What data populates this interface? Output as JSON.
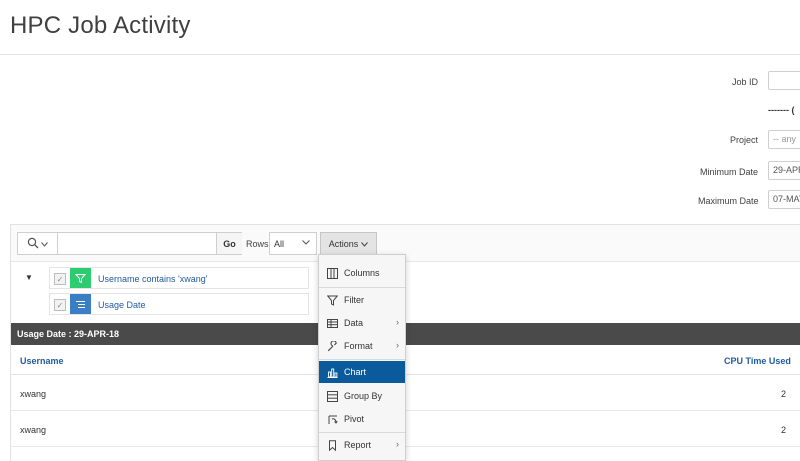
{
  "page": {
    "title": "HPC Job Activity"
  },
  "form": {
    "job_id_label": "Job ID",
    "job_id_value": "",
    "separator_text": "------- (",
    "project_label": "Project",
    "project_placeholder": "-- any",
    "min_date_label": "Minimum Date",
    "min_date_value": "29-APR",
    "max_date_label": "Maximum Date",
    "max_date_value": "07-MAY"
  },
  "toolbar": {
    "search_value": "",
    "go_label": "Go",
    "rows_label": "Rows",
    "rows_value": "All",
    "actions_label": "Actions"
  },
  "filters": [
    {
      "text": "Username contains 'xwang'",
      "icon": "filter-icon",
      "color": "#2ecc71"
    },
    {
      "text": "Usage Date",
      "icon": "control-break-icon",
      "color": "#3a7fc4"
    }
  ],
  "report": {
    "break_label": "Usage Date : 29-APR-18",
    "columns": {
      "username": "Username",
      "cpu_time": "CPU Time Used"
    },
    "rows": [
      {
        "username": "xwang",
        "cpu_time": "2"
      },
      {
        "username": "xwang",
        "cpu_time": "2"
      }
    ]
  },
  "menu": {
    "items": [
      {
        "label": "Columns",
        "icon": "columns-icon"
      },
      {
        "label": "Filter",
        "icon": "filter-icon"
      },
      {
        "label": "Data",
        "icon": "table-icon",
        "submenu": true
      },
      {
        "label": "Format",
        "icon": "wrench-icon",
        "submenu": true
      },
      {
        "label": "Chart",
        "icon": "bar-chart-icon",
        "active": true
      },
      {
        "label": "Group By",
        "icon": "group-by-icon"
      },
      {
        "label": "Pivot",
        "icon": "pivot-icon"
      },
      {
        "label": "Report",
        "icon": "bookmark-icon",
        "submenu": true
      }
    ]
  },
  "colors": {
    "accent": "#0a5a9c",
    "link": "#1f5b9e",
    "break_bg": "#4a4a4a",
    "filter_green": "#2ecc71",
    "filter_blue": "#3a7fc4"
  }
}
